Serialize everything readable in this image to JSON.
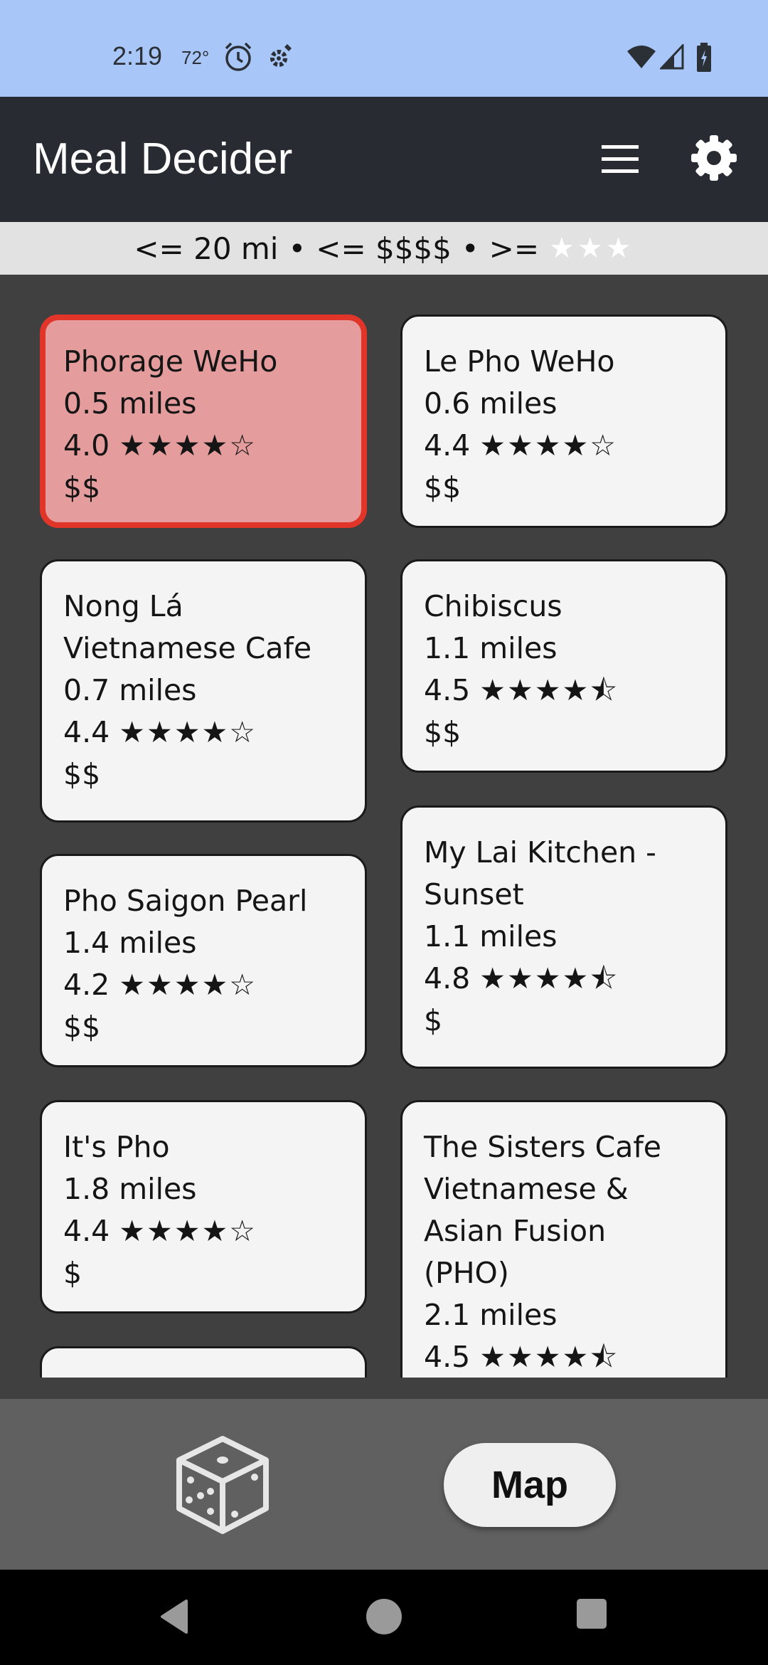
{
  "status_bar": {
    "time": "2:19",
    "temperature": "72°",
    "icons": [
      "alarm-icon",
      "location-settings-icon",
      "wifi-icon",
      "signal-icon",
      "battery-icon"
    ]
  },
  "app_bar": {
    "title": "Meal Decider",
    "icons": [
      "menu-icon",
      "gear-icon"
    ]
  },
  "filters": {
    "distance": "<= 20 mi",
    "separator": "•",
    "price": "<= $$$$",
    "rating_prefix": ">=",
    "rating_stars": "★★★"
  },
  "restaurants": [
    {
      "name_lines": [
        "Phorage WeHo"
      ],
      "distance": "0.5 miles",
      "rating": "4.0",
      "stars": "★★★★☆",
      "price": "$$",
      "selected": true
    },
    {
      "name_lines": [
        "Le Pho WeHo"
      ],
      "distance": "0.6 miles",
      "rating": "4.4",
      "stars": "★★★★☆",
      "price": "$$"
    },
    {
      "name_lines": [
        "Nong Lá",
        "Vietnamese Cafe"
      ],
      "distance": "0.7 miles",
      "rating": "4.4",
      "stars": "★★★★☆",
      "price": "$$"
    },
    {
      "name_lines": [
        "Chibiscus"
      ],
      "distance": "1.1 miles",
      "rating": "4.5",
      "stars": "★★★★⯪",
      "price": "$$"
    },
    {
      "name_lines": [
        "Pho Saigon Pearl"
      ],
      "distance": "1.4 miles",
      "rating": "4.2",
      "stars": "★★★★☆",
      "price": "$$"
    },
    {
      "name_lines": [
        "My Lai Kitchen -",
        "Sunset"
      ],
      "distance": "1.1 miles",
      "rating": "4.8",
      "stars": "★★★★⯪",
      "price": "$"
    },
    {
      "name_lines": [
        "It's Pho"
      ],
      "distance": "1.8 miles",
      "rating": "4.4",
      "stars": "★★★★☆",
      "price": "$"
    },
    {
      "name_lines": [
        "The Sisters Cafe",
        "Vietnamese &",
        "Asian Fusion",
        "(PHO)"
      ],
      "distance": "2.1 miles",
      "rating": "4.5",
      "stars": "★★★★⯪",
      "price": ""
    }
  ],
  "bottom_bar": {
    "dice_icon": "dice-icon",
    "map_label": "Map"
  },
  "nav_bar": {
    "icons": [
      "back-icon",
      "home-icon",
      "recents-icon"
    ]
  },
  "colors": {
    "status_bar": "#a8c7f8",
    "app_bar": "#282c32",
    "background": "#404040",
    "selected_card": "#e59c9c",
    "selected_border": "#e2352a"
  }
}
